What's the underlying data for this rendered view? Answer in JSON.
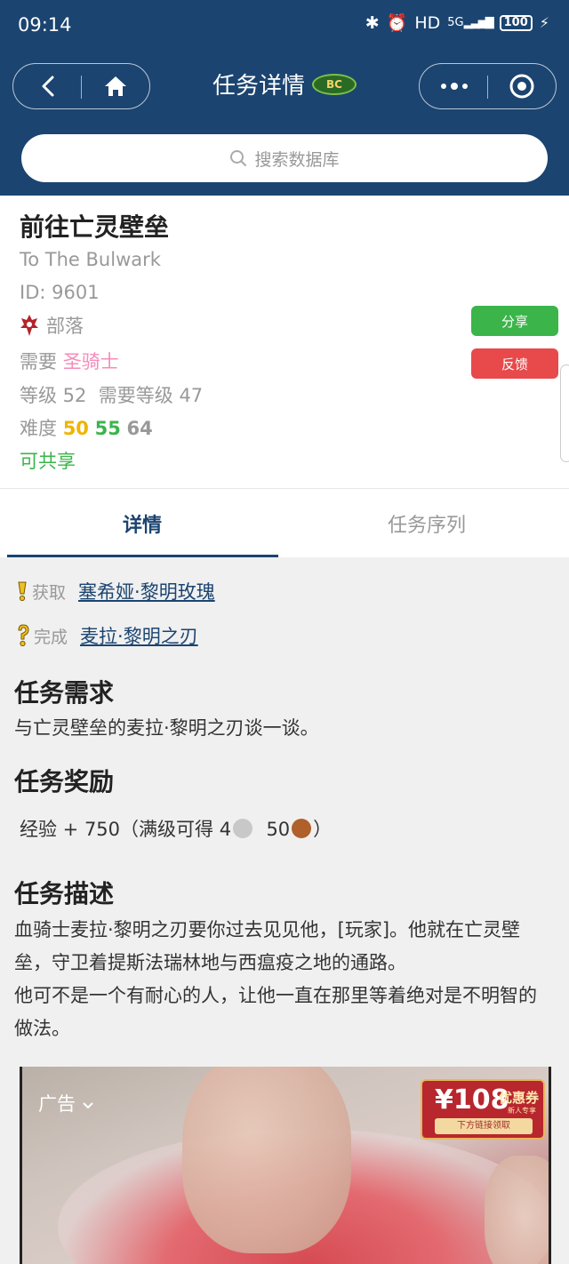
{
  "status_bar": {
    "time": "09:14",
    "hd": "HD",
    "network": "5G",
    "battery": "100"
  },
  "header": {
    "title": "任务详情",
    "logo_text": "BC",
    "search_placeholder": "搜索数据库"
  },
  "quest": {
    "name_cn": "前往亡灵壁垒",
    "name_en": "To The Bulwark",
    "id_text": "ID: 9601",
    "faction": "部落",
    "require_label": "需要",
    "require_class": "圣骑士",
    "level_text": "等级 52",
    "req_level_text": "需要等级 47",
    "difficulty_label": "难度",
    "difficulty": [
      "50",
      "55",
      "64"
    ],
    "shareable": "可共享",
    "share_button": "分享",
    "feedback_button": "反馈",
    "colors": {
      "difficulty_yellow": "#f0b400",
      "difficulty_green": "#3bb54a",
      "difficulty_grey": "#999999",
      "class_color": "#f48cba"
    }
  },
  "tabs": [
    {
      "label": "详情",
      "active": true
    },
    {
      "label": "任务序列",
      "active": false
    }
  ],
  "npcs": {
    "start_label": "获取",
    "start_npc": "塞希娅·黎明玫瑰",
    "end_label": "完成",
    "end_npc": "麦拉·黎明之刃"
  },
  "objective": {
    "title": "任务需求",
    "text": "与亡灵壁垒的麦拉·黎明之刃谈一谈。"
  },
  "rewards": {
    "title": "任务奖励",
    "xp_text": "经验 + 750（满级可得 4",
    "silver": "4",
    "copper": "50",
    "close_paren": "）"
  },
  "description": {
    "title": "任务描述",
    "text1": "血骑士麦拉·黎明之刃要你过去见见他，[玩家]。他就在亡灵壁垒，守卫着提斯法瑞林地与西瘟疫之地的通路。",
    "text2": "他可不是一个有耐心的人，让他一直在那里等着绝对是不明智的做法。"
  },
  "ad": {
    "label": "广告",
    "coupon_amount": "¥108",
    "coupon_title": "优惠券",
    "coupon_sub": "新人专享",
    "coupon_action": "下方链接领取"
  }
}
